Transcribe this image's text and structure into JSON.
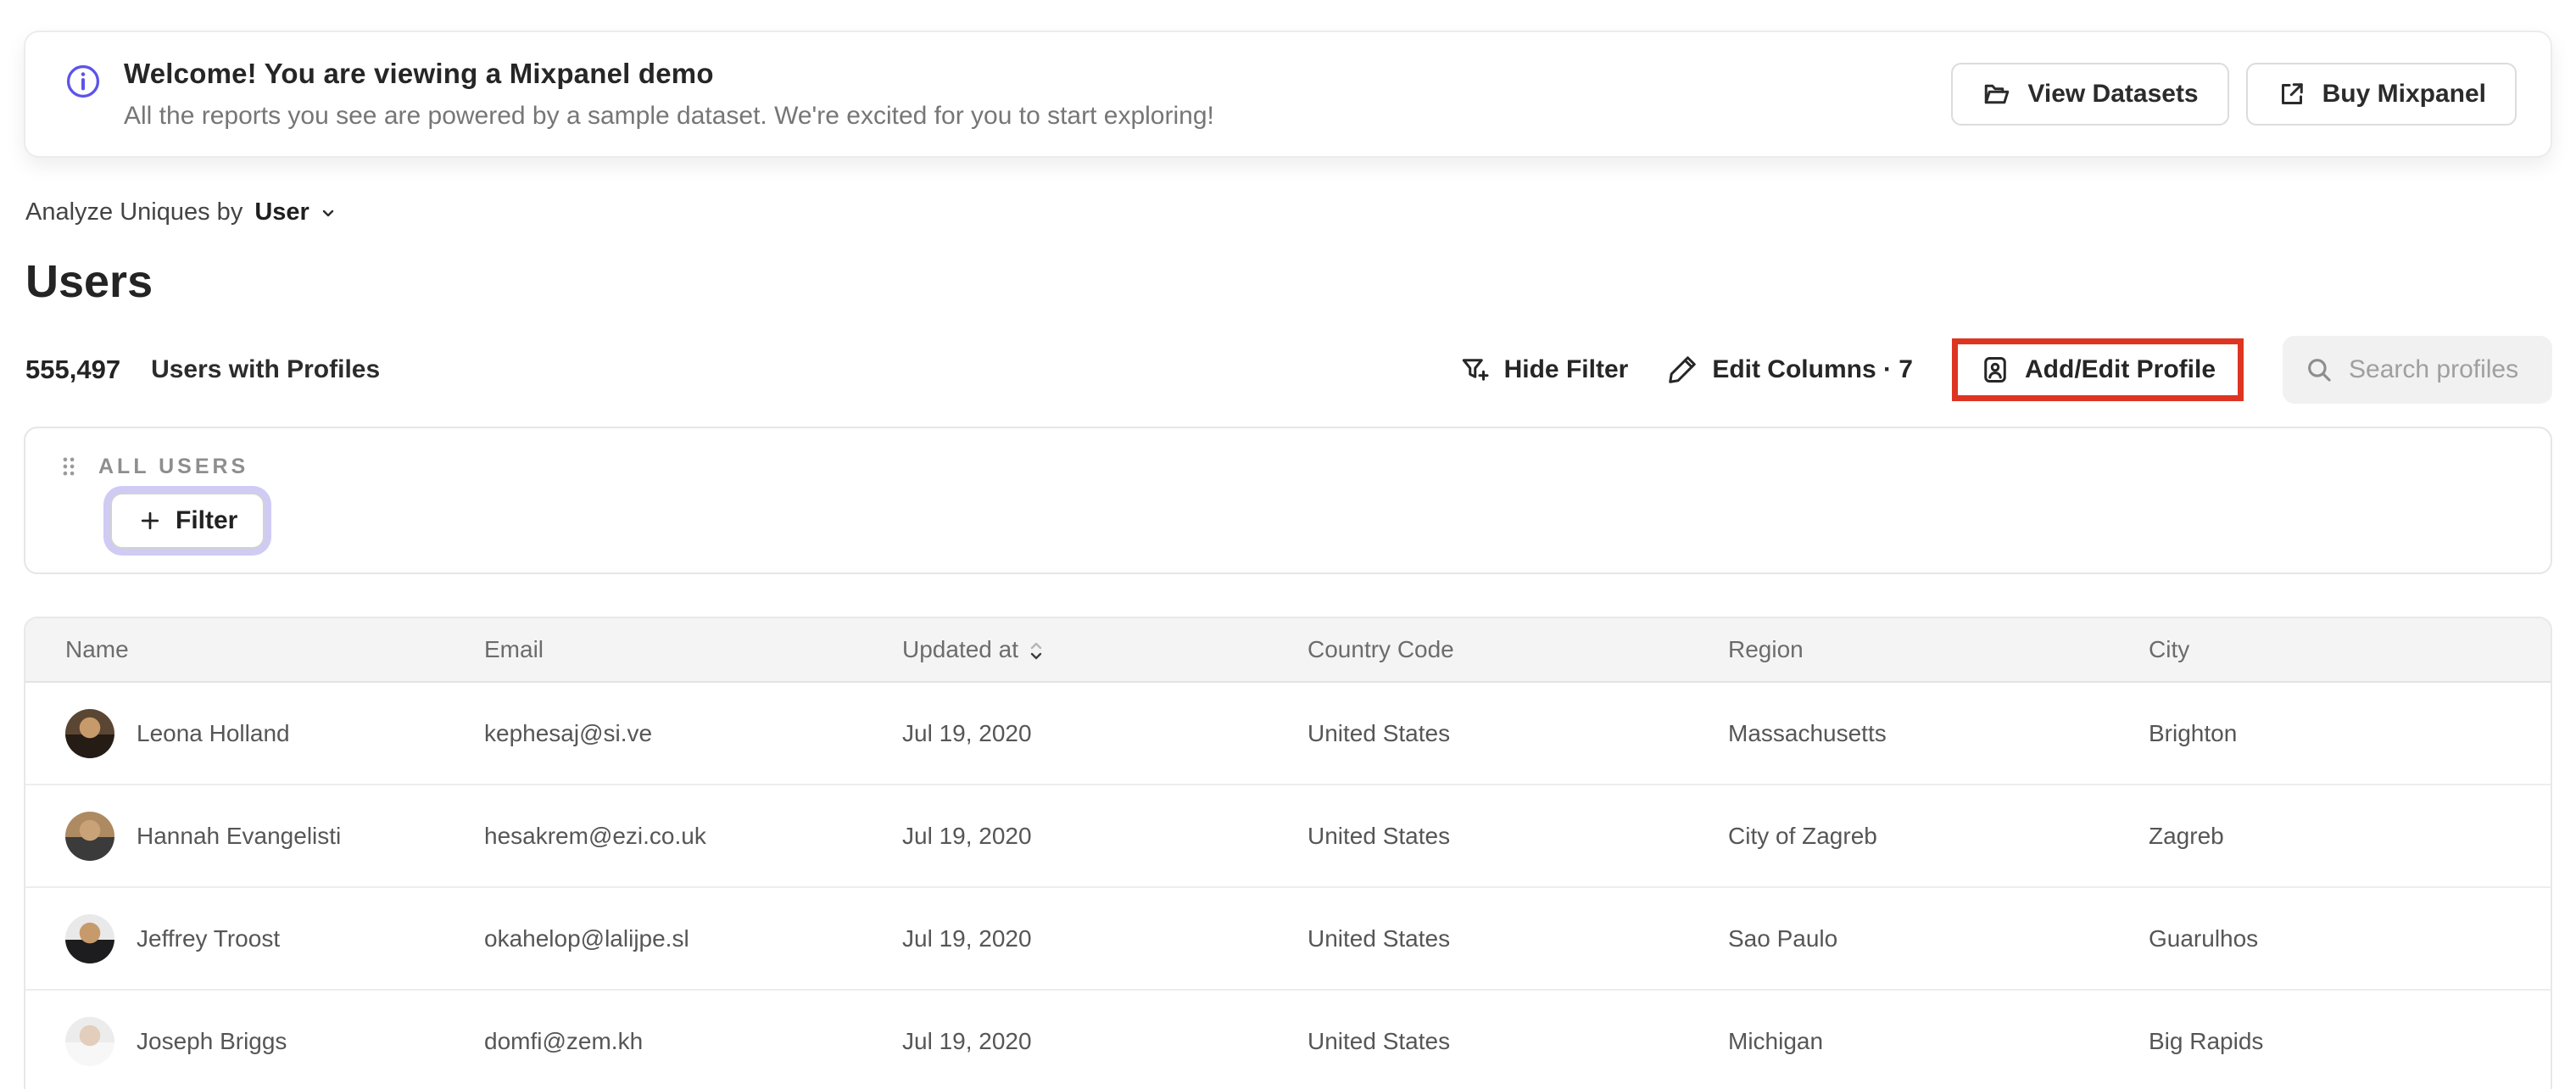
{
  "banner": {
    "title": "Welcome! You are viewing a Mixpanel demo",
    "subtitle": "All the reports you see are powered by a sample dataset. We're excited for you to start exploring!",
    "view_datasets_label": "View Datasets",
    "buy_mixpanel_label": "Buy Mixpanel"
  },
  "analyze": {
    "prefix": "Analyze Uniques by",
    "selected": "User"
  },
  "page_title": "Users",
  "profile_count": {
    "value": "555,497",
    "label": "Users with Profiles"
  },
  "toolbar": {
    "hide_filter_label": "Hide Filter",
    "edit_columns_label": "Edit Columns · 7",
    "add_edit_profile_label": "Add/Edit Profile",
    "search_placeholder": "Search profiles"
  },
  "filter_panel": {
    "group_label": "ALL USERS",
    "add_filter_label": "Filter"
  },
  "table": {
    "columns": [
      "Name",
      "Email",
      "Updated at",
      "Country Code",
      "Region",
      "City"
    ],
    "sorted_column": "Updated at",
    "rows": [
      {
        "name": "Leona Holland",
        "email": "kephesaj@si.ve",
        "updated_at": "Jul 19, 2020",
        "country_code": "United States",
        "region": "Massachusetts",
        "city": "Brighton",
        "avatar_colors": [
          "#5a4632",
          "#241c15",
          "#c79a6b"
        ]
      },
      {
        "name": "Hannah Evangelisti",
        "email": "hesakrem@ezi.co.uk",
        "updated_at": "Jul 19, 2020",
        "country_code": "United States",
        "region": "City of Zagreb",
        "city": "Zagreb",
        "avatar_colors": [
          "#ad8a62",
          "#3b3b3b",
          "#caa277"
        ]
      },
      {
        "name": "Jeffrey Troost",
        "email": "okahelop@lalijpe.sl",
        "updated_at": "Jul 19, 2020",
        "country_code": "United States",
        "region": "Sao Paulo",
        "city": "Guarulhos",
        "avatar_colors": [
          "#e9e9e9",
          "#1d1d1f",
          "#c79a6b"
        ]
      },
      {
        "name": "Joseph Briggs",
        "email": "domfi@zem.kh",
        "updated_at": "Jul 19, 2020",
        "country_code": "United States",
        "region": "Michigan",
        "city": "Big Rapids",
        "avatar_colors": [
          "#ececec",
          "#f7f7f7",
          "#e3cdbb"
        ]
      }
    ]
  },
  "colors": {
    "accent_purple": "#5c54e8",
    "focus_ring_purple": "#cfcbf4",
    "annotation_red": "#dd3522",
    "table_header_bg": "#f4f4f4",
    "search_bg": "#f1f1f1"
  }
}
